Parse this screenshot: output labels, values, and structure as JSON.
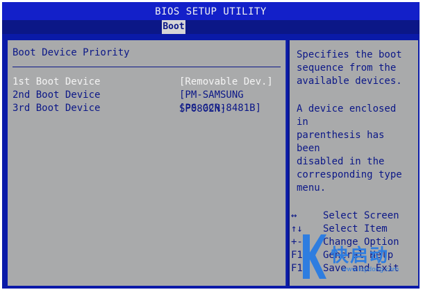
{
  "header": {
    "title": "BIOS SETUP UTILITY",
    "active_tab": "Boot"
  },
  "main": {
    "heading": "Boot Device Priority",
    "rows": [
      {
        "label": "1st Boot Device",
        "value": "[Removable Dev.]",
        "selected": true
      },
      {
        "label": "2nd Boot Device",
        "value": "[PM-SAMSUNG SP0802N]",
        "selected": false
      },
      {
        "label": "3rd Boot Device",
        "value": "[PS-GCR-8481B]",
        "selected": false
      }
    ]
  },
  "help": {
    "paragraph1": "Specifies the boot\nsequence from the\navailable devices.",
    "paragraph2": "A device enclosed in\nparenthesis has been\ndisabled in the\ncorresponding type\nmenu.",
    "keys": [
      {
        "key": "↔",
        "desc": "Select Screen"
      },
      {
        "key": "↑↓",
        "desc": "Select Item"
      },
      {
        "key": "+-",
        "desc": "Change Option"
      },
      {
        "key": "F1",
        "desc": "General Help"
      },
      {
        "key": "F10",
        "desc": "Save and Exit"
      }
    ]
  },
  "watermark": {
    "text": "快启动",
    "url": "www.kqidong.com"
  },
  "colors": {
    "bios_blue": "#0a1aa8",
    "panel_grey": "#a9aaab",
    "text_blue": "#0b1787",
    "selected_text": "#f4f4f4",
    "watermark_blue": "#2e7de0"
  }
}
